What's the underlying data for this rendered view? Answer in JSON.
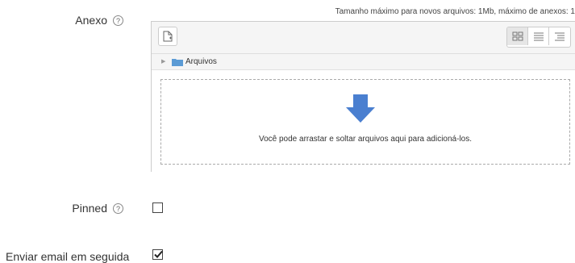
{
  "anexo": {
    "label": "Anexo",
    "help_icon": "help-circle-icon",
    "size_info": "Tamanho máximo para novos arquivos: 1Mb, máximo de anexos: 1",
    "path": "Arquivos",
    "drop_text": "Você pode arrastar e soltar arquivos aqui para adicioná-los.",
    "view_modes": [
      "icons-view-icon",
      "list-view-icon",
      "tree-view-icon"
    ],
    "active_view": "icons-view-icon"
  },
  "pinned": {
    "label": "Pinned",
    "checked": false
  },
  "email": {
    "label": "Enviar email em seguida",
    "checked": true
  },
  "colors": {
    "drop_arrow": "#4a7fd0",
    "folder": "#5b9bd5"
  }
}
